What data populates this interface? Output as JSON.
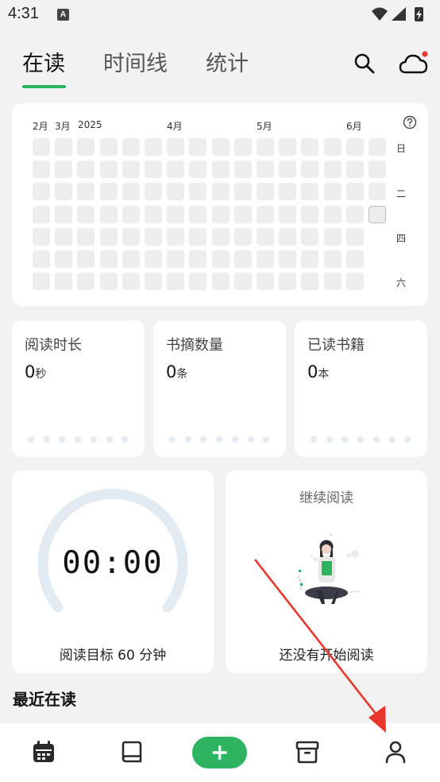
{
  "status_bar": {
    "time": "4:31",
    "a_badge": "A",
    "icons": [
      "wifi-icon",
      "cellular-signal-icon",
      "battery-charging-icon"
    ]
  },
  "tabs": [
    {
      "label": "在读",
      "active": true
    },
    {
      "label": "时间线",
      "active": false
    },
    {
      "label": "统计",
      "active": false
    }
  ],
  "header_icons": {
    "search": "search-icon",
    "cloud": "cloud-sync-icon",
    "cloud_badge_color": "#e53935"
  },
  "heatmap": {
    "months": [
      "2月",
      "3月",
      "2025",
      "4月",
      "5月",
      "6月"
    ],
    "days": [
      "日",
      "二",
      "四",
      "六"
    ],
    "help_icon": "help-icon"
  },
  "stats": [
    {
      "title": "阅读时长",
      "value": "0",
      "unit": "秒"
    },
    {
      "title": "书摘数量",
      "value": "0",
      "unit": "条"
    },
    {
      "title": "已读书籍",
      "value": "0",
      "unit": "本"
    }
  ],
  "timer": {
    "display": "00:00",
    "goal": "阅读目标 60 分钟"
  },
  "continue_reading": {
    "title": "继续阅读",
    "empty": "还没有开始阅读"
  },
  "recent": {
    "title": "最近在读"
  },
  "bottom_nav": [
    {
      "icon": "calendar-icon"
    },
    {
      "icon": "book-icon"
    },
    {
      "icon": "add-icon"
    },
    {
      "icon": "archive-icon"
    },
    {
      "icon": "person-icon"
    }
  ],
  "colors": {
    "accent": "#2eb461",
    "arrow": "#e8362a"
  }
}
